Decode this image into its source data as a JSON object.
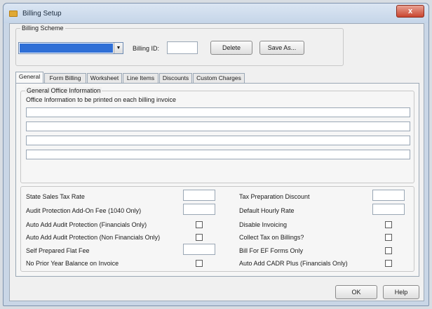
{
  "window": {
    "title": "Billing Setup",
    "close_label": "x"
  },
  "billing_scheme": {
    "group_label": "Billing Scheme",
    "billing_id_label": "Billing ID:",
    "billing_id_value": "",
    "delete_label": "Delete",
    "save_as_label": "Save As..."
  },
  "tabs": [
    {
      "label": "General",
      "active": true
    },
    {
      "label": "Form Billing"
    },
    {
      "label": "Worksheet"
    },
    {
      "label": "Line Items"
    },
    {
      "label": "Discounts"
    },
    {
      "label": "Custom Charges"
    }
  ],
  "general": {
    "office_group_label": "General Office Information",
    "office_description": "Office Information to be printed on each billing invoice",
    "office_lines": [
      "",
      "",
      "",
      ""
    ],
    "left_fields": [
      {
        "label": "State Sales Tax Rate",
        "type": "text",
        "value": ""
      },
      {
        "label": "Audit Protection Add-On Fee (1040 Only)",
        "type": "text",
        "value": ""
      },
      {
        "label": "Auto Add Audit Protection (Financials Only)",
        "type": "checkbox",
        "checked": false
      },
      {
        "label": "Auto Add Audit Protection (Non Financials Only)",
        "type": "checkbox",
        "checked": false
      },
      {
        "label": "Self Prepared Flat Fee",
        "type": "text",
        "value": ""
      },
      {
        "label": "No Prior Year Balance on Invoice",
        "type": "checkbox",
        "checked": false
      }
    ],
    "right_fields": [
      {
        "label": "Tax Preparation Discount",
        "type": "text",
        "value": ""
      },
      {
        "label": "Default Hourly Rate",
        "type": "text",
        "value": ""
      },
      {
        "label": "Disable Invoicing",
        "type": "checkbox",
        "checked": false
      },
      {
        "label": "Collect Tax on Billings?",
        "type": "checkbox",
        "checked": false
      },
      {
        "label": "Bill For EF Forms Only",
        "type": "checkbox",
        "checked": false
      },
      {
        "label": "Auto Add CADR Plus (Financials Only)",
        "type": "checkbox",
        "checked": false
      }
    ]
  },
  "footer": {
    "ok_label": "OK",
    "help_label": "Help"
  },
  "colors": {
    "combo_selection": "#2f6fd6",
    "title_bar": "#c5d5e8",
    "close_button": "#c9452f"
  }
}
